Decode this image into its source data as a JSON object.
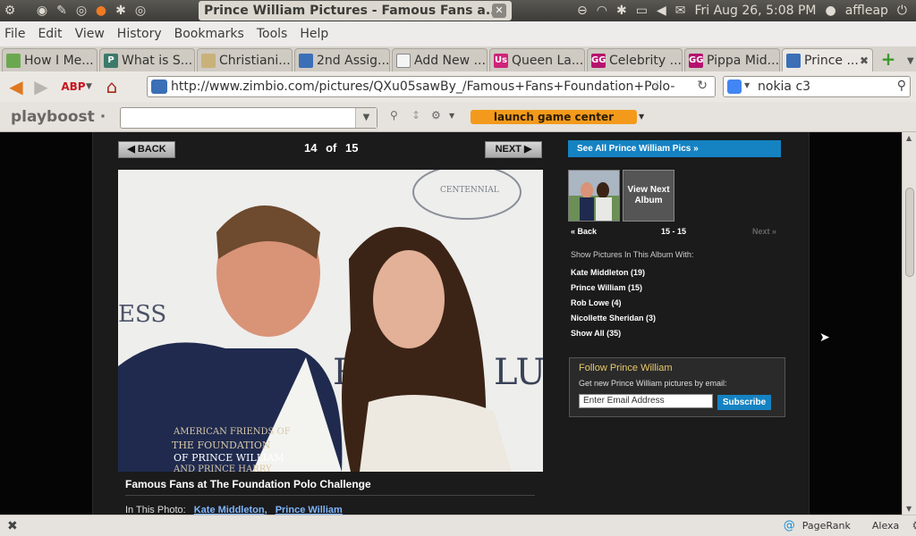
{
  "window": {
    "title": "Prince William Pictures - Famous Fans a...",
    "close": "✕"
  },
  "tray": {
    "datetime": "Fri Aug 26,  5:08 PM",
    "user": "affleap"
  },
  "menu": [
    "File",
    "Edit",
    "View",
    "History",
    "Bookmarks",
    "Tools",
    "Help"
  ],
  "tabs": [
    {
      "label": "How I Me...",
      "fav": "",
      "color": "#6aa84f"
    },
    {
      "label": "What is S...",
      "fav": "P",
      "color": "#3b7a6a"
    },
    {
      "label": "Christiani...",
      "fav": "",
      "color": "#c9b27a"
    },
    {
      "label": "2nd Assig...",
      "fav": "",
      "color": "#3b6fb6"
    },
    {
      "label": "Add New ...",
      "fav": "",
      "color": "#f4f4f4"
    },
    {
      "label": "Queen La...",
      "fav": "Us",
      "color": "#d0237a"
    },
    {
      "label": "Celebrity ...",
      "fav": "GG",
      "color": "#b5126e"
    },
    {
      "label": "Pippa Mid...",
      "fav": "GG",
      "color": "#b5126e"
    },
    {
      "label": "Prince ...",
      "fav": "",
      "color": "#3b6fb6",
      "active": true
    }
  ],
  "nav": {
    "url": "http://www.zimbio.com/pictures/QXu05sawBy_/Famous+Fans+Foundation+Polo-",
    "search": "nokia c3"
  },
  "pb": {
    "logo": "playboost ·",
    "launch": "launch game center"
  },
  "page": {
    "back": "◀ BACK",
    "next": "NEXT ▶",
    "counter_current": "14",
    "counter_of": "of",
    "counter_total": "15",
    "caption": "Famous Fans at The Foundation Polo Challenge",
    "in_photo_label": "In This Photo:",
    "in_photo": [
      "Kate Middleton,",
      "Prince William"
    ],
    "photo_text_1": "AMERICAN FRIENDS OF",
    "photo_text_2": "THE FOUNDATION",
    "photo_text_3": "OF PRINCE WILLIAM",
    "photo_text_4": "AND PRINCE HARRY",
    "photo_text_5": "CENTENNIAL",
    "photo_text_6": "RO",
    "photo_text_7": "LU",
    "photo_text_8": "ESS"
  },
  "side": {
    "see_all": "See All Prince William Pics »",
    "view_next": "View Next Album",
    "pager_back": "« Back",
    "pager_range": "15 - 15",
    "pager_next": "Next »",
    "show_label": "Show Pictures In This Album With:",
    "filters": [
      "Kate Middleton (19)",
      "Prince William (15)",
      "Rob Lowe (4)",
      "Nicollette Sheridan (3)",
      "Show All (35)"
    ],
    "follow_title": "Follow Prince William",
    "follow_sub": "Get new Prince William pictures by email:",
    "email_placeholder": "Enter Email Address",
    "subscribe": "Subscribe"
  },
  "status": {
    "pagerank": "PageRank",
    "alexa": "Alexa"
  }
}
